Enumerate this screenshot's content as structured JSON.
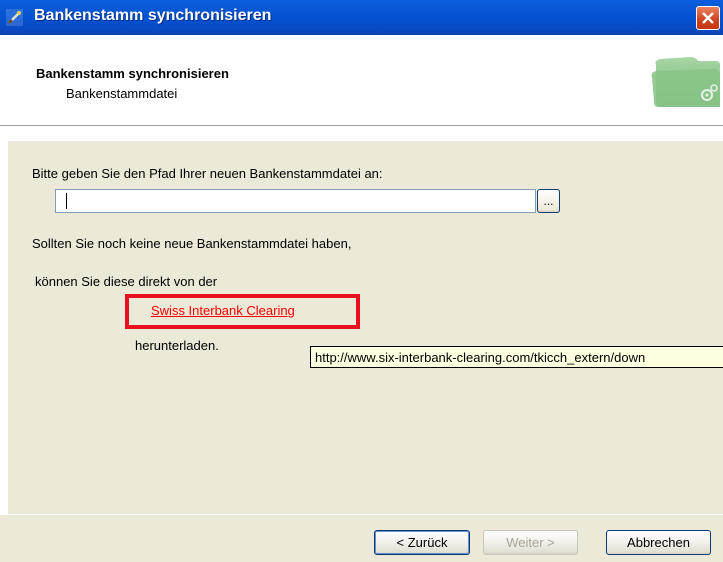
{
  "window": {
    "title": "Bankenstamm synchronisieren",
    "icons": {
      "app": "app-wand-icon",
      "close": "close-icon"
    }
  },
  "header": {
    "title": "Bankenstamm synchronisieren",
    "subtitle": "Bankenstammdatei",
    "graphic": "folder-gears-icon"
  },
  "body": {
    "prompt": "Bitte geben Sie den Pfad Ihrer neuen Bankenstammdatei an:",
    "path_value": "",
    "browse_label": "...",
    "line1": "Sollten Sie noch keine neue Bankenstammdatei haben,",
    "line2": "können Sie diese direkt von der",
    "link_text": "Swiss Interbank Clearing",
    "after_link": "herunterladen.",
    "tooltip": "http://www.six-interbank-clearing.com/tkicch_extern/down"
  },
  "footer": {
    "back_label": "< Zurück",
    "next_label": "Weiter >",
    "cancel_label": "Abbrechen"
  },
  "colors": {
    "titlebar": "#0353d2",
    "face": "#ece9d8",
    "link": "#ff0000",
    "highlight_box": "#e8101f",
    "tooltip_bg": "#ffffe1"
  }
}
